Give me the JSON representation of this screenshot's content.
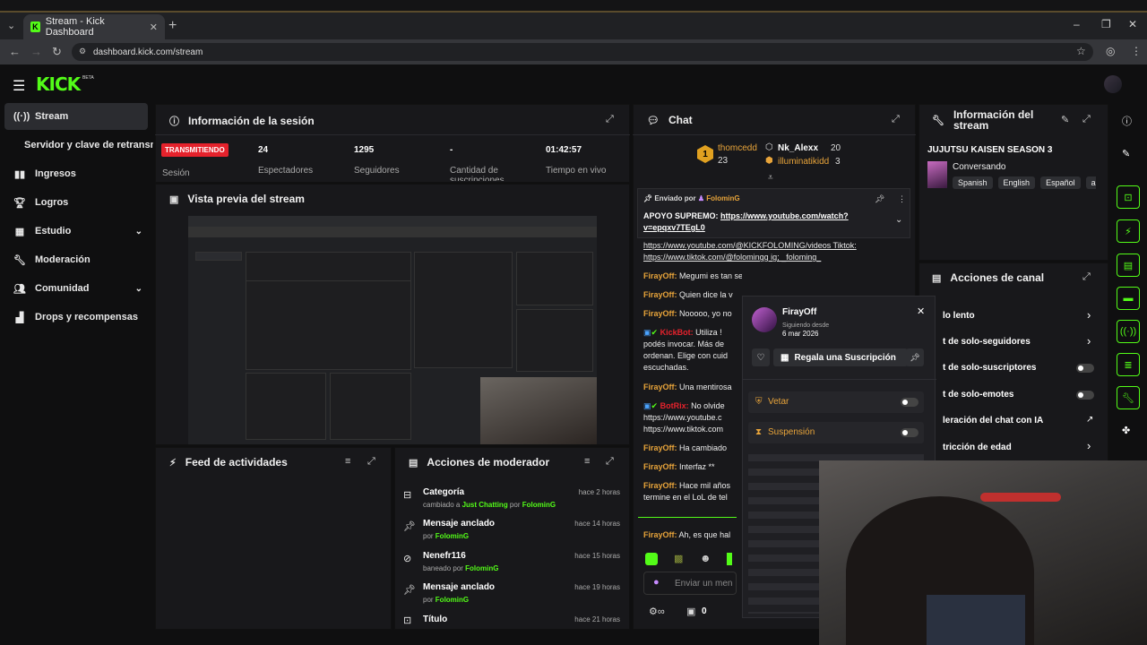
{
  "browser": {
    "tab_title": "Stream - Kick Dashboard",
    "url": "dashboard.kick.com/stream"
  },
  "app": {
    "logo": "KICK",
    "beta": "BETA"
  },
  "sidebar": {
    "items": [
      {
        "label": "Stream",
        "icon": "broadcast-icon"
      },
      {
        "label": "Servidor y clave de retransmisión",
        "icon": ""
      },
      {
        "label": "Ingresos",
        "icon": "chart-icon"
      },
      {
        "label": "Logros",
        "icon": "trophy-icon"
      },
      {
        "label": "Estudio",
        "icon": "grid-icon"
      },
      {
        "label": "Moderación",
        "icon": "wrench-icon"
      },
      {
        "label": "Comunidad",
        "icon": "people-icon"
      },
      {
        "label": "Drops y recompensas",
        "icon": "gift-icon"
      }
    ]
  },
  "session": {
    "title": "Información de la sesión",
    "status": "TRANSMITIENDO",
    "status_label": "Sesión",
    "stats": [
      {
        "value": "24",
        "label": "Espectadores"
      },
      {
        "value": "1295",
        "label": "Seguidores"
      },
      {
        "value": "-",
        "label": "Cantidad de suscripciones"
      },
      {
        "value": "01:42:57",
        "label": "Tiempo en vivo"
      }
    ]
  },
  "preview": {
    "title": "Vista previa del stream"
  },
  "feed": {
    "title": "Feed de actividades"
  },
  "modactions": {
    "title": "Acciones de moderador",
    "rows": [
      {
        "title": "Categoría",
        "sub_pre": "cambiado a ",
        "sub_hl": "Just Chatting",
        "sub_mid": " por ",
        "sub_user": "FolominG",
        "time": "hace 2 horas"
      },
      {
        "title": "Mensaje anclado",
        "sub_pre": "por ",
        "sub_hl": "",
        "sub_mid": "",
        "sub_user": "FolominG",
        "time": "hace 14 horas"
      },
      {
        "title": "Nenefr116",
        "sub_pre": "baneado por ",
        "sub_hl": "",
        "sub_mid": "",
        "sub_user": "FolominG",
        "time": "hace 15 horas"
      },
      {
        "title": "Mensaje anclado",
        "sub_pre": "por ",
        "sub_hl": "",
        "sub_mid": "",
        "sub_user": "FolominG",
        "time": "hace 19 horas"
      },
      {
        "title": "Título",
        "sub_pre": "",
        "sub_hl": "",
        "sub_mid": "",
        "sub_user": "",
        "time": "hace 21 horas"
      }
    ]
  },
  "chat": {
    "title": "Chat",
    "top": [
      {
        "rank": "1",
        "name": "thomcedd",
        "count": "23"
      },
      {
        "name": "Nk_Alexx",
        "count": "20"
      },
      {
        "name": "illuminatikidd",
        "count": "3"
      }
    ],
    "pinned_by": "Enviado por",
    "pinned_user": "FolominG",
    "pinned_text": "APOYO SUPREMO: ",
    "pinned_link": "https://www.youtube.com/watch?v=epqxv7TEgL0",
    "messages": [
      {
        "user": "",
        "text": "https://www.youtube.com/@KICKFOLOMING/videos Tiktok: https://www.tiktok.com/@folomingg ig; _foloming_"
      },
      {
        "user": "FirayOff:",
        "text": "Megumi es tan seco jajaja"
      },
      {
        "user": "FirayOff:",
        "text": "Quien dice la v"
      },
      {
        "user": "FirayOff:",
        "text": "Nooooo, yo no"
      },
      {
        "user": "KickBot:",
        "text": "Utiliza ! podés invocar. Más de ordenan. Elige con cuid escuchadas."
      },
      {
        "user": "FirayOff:",
        "text": "Una mentirosa"
      },
      {
        "user": "BotRix:",
        "text": "No olvide https://www.youtube.c https://www.tiktok.com"
      },
      {
        "user": "FirayOff:",
        "text": "Ha cambiado"
      },
      {
        "user": "FirayOff:",
        "text": "Interfaz **"
      },
      {
        "user": "FirayOff:",
        "text": "Hace mil años termine en el LoL de tel"
      },
      {
        "user": "FirayOff:",
        "text": "Ah, es que hal"
      }
    ],
    "input_placeholder": "Enviar un men",
    "points": "0"
  },
  "popup": {
    "name": "FirayOff",
    "since_label": "Siguiendo desde",
    "since": "6 mar 2026",
    "gift": "Regala una Suscripción",
    "vetar": "Vetar",
    "suspension": "Suspensión"
  },
  "streaminfo": {
    "title": "Información del stream",
    "game": "JUJUTSU KAISEN SEASON 3",
    "category": "Conversando",
    "tags": [
      "Spanish",
      "English",
      "Español",
      "a"
    ]
  },
  "channel": {
    "title": "Acciones de canal",
    "items": [
      {
        "label": "lo lento",
        "ctrl": "chevron"
      },
      {
        "label": "t de solo-seguidores",
        "ctrl": "chevron"
      },
      {
        "label": "t de solo-suscriptores",
        "ctrl": "toggle"
      },
      {
        "label": "t de solo-emotes",
        "ctrl": "toggle"
      },
      {
        "label": "leración del chat con IA",
        "ctrl": "external"
      },
      {
        "label": "tricción de edad",
        "ctrl": "chevron"
      }
    ]
  },
  "colors": {
    "brand": "#53fc18",
    "live": "#e5222c",
    "username": "#e8a43a"
  }
}
